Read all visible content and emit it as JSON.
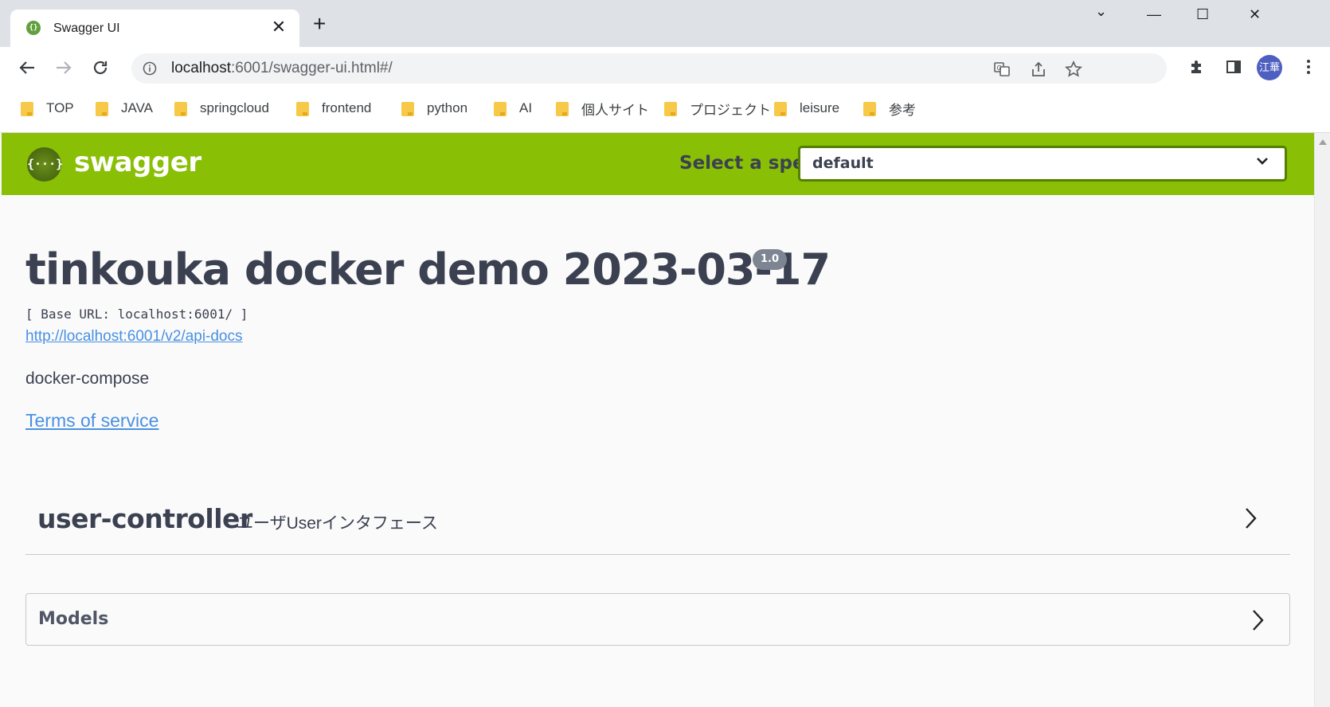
{
  "browser": {
    "tab_title": "Swagger UI",
    "tab_close": "✕",
    "new_tab": "+",
    "window_controls": {
      "minimize": "—",
      "maximize": "☐",
      "close": "✕",
      "tab_search": "⌄"
    },
    "address": {
      "host": "localhost",
      "rest": ":6001/swagger-ui.html#/"
    },
    "profile_initials": "江華",
    "bookmarks": [
      {
        "label": "TOP"
      },
      {
        "label": "JAVA"
      },
      {
        "label": "springcloud"
      },
      {
        "label": "frontend"
      },
      {
        "label": "python"
      },
      {
        "label": "AI"
      },
      {
        "label": "個人サイト"
      },
      {
        "label": "プロジェクト"
      },
      {
        "label": "leisure"
      },
      {
        "label": "参考"
      }
    ]
  },
  "swagger": {
    "brand": "swagger",
    "logo_glyph": "{···}",
    "select_spec_label": "Select a spec",
    "selected_spec": "default",
    "title": "tinkouka docker demo 2023-03-17",
    "version": "1.0",
    "base_url": "[ Base URL: localhost:6001/ ]",
    "spec_link": "http://localhost:6001/v2/api-docs",
    "description": "docker-compose",
    "terms": "Terms of service",
    "tag": {
      "name": "user-controller",
      "description": "ユーザUserインタフェース"
    },
    "models_label": "Models"
  },
  "colors": {
    "topbar": "#89bf04",
    "link": "#4990e2",
    "text": "#3b4151"
  }
}
